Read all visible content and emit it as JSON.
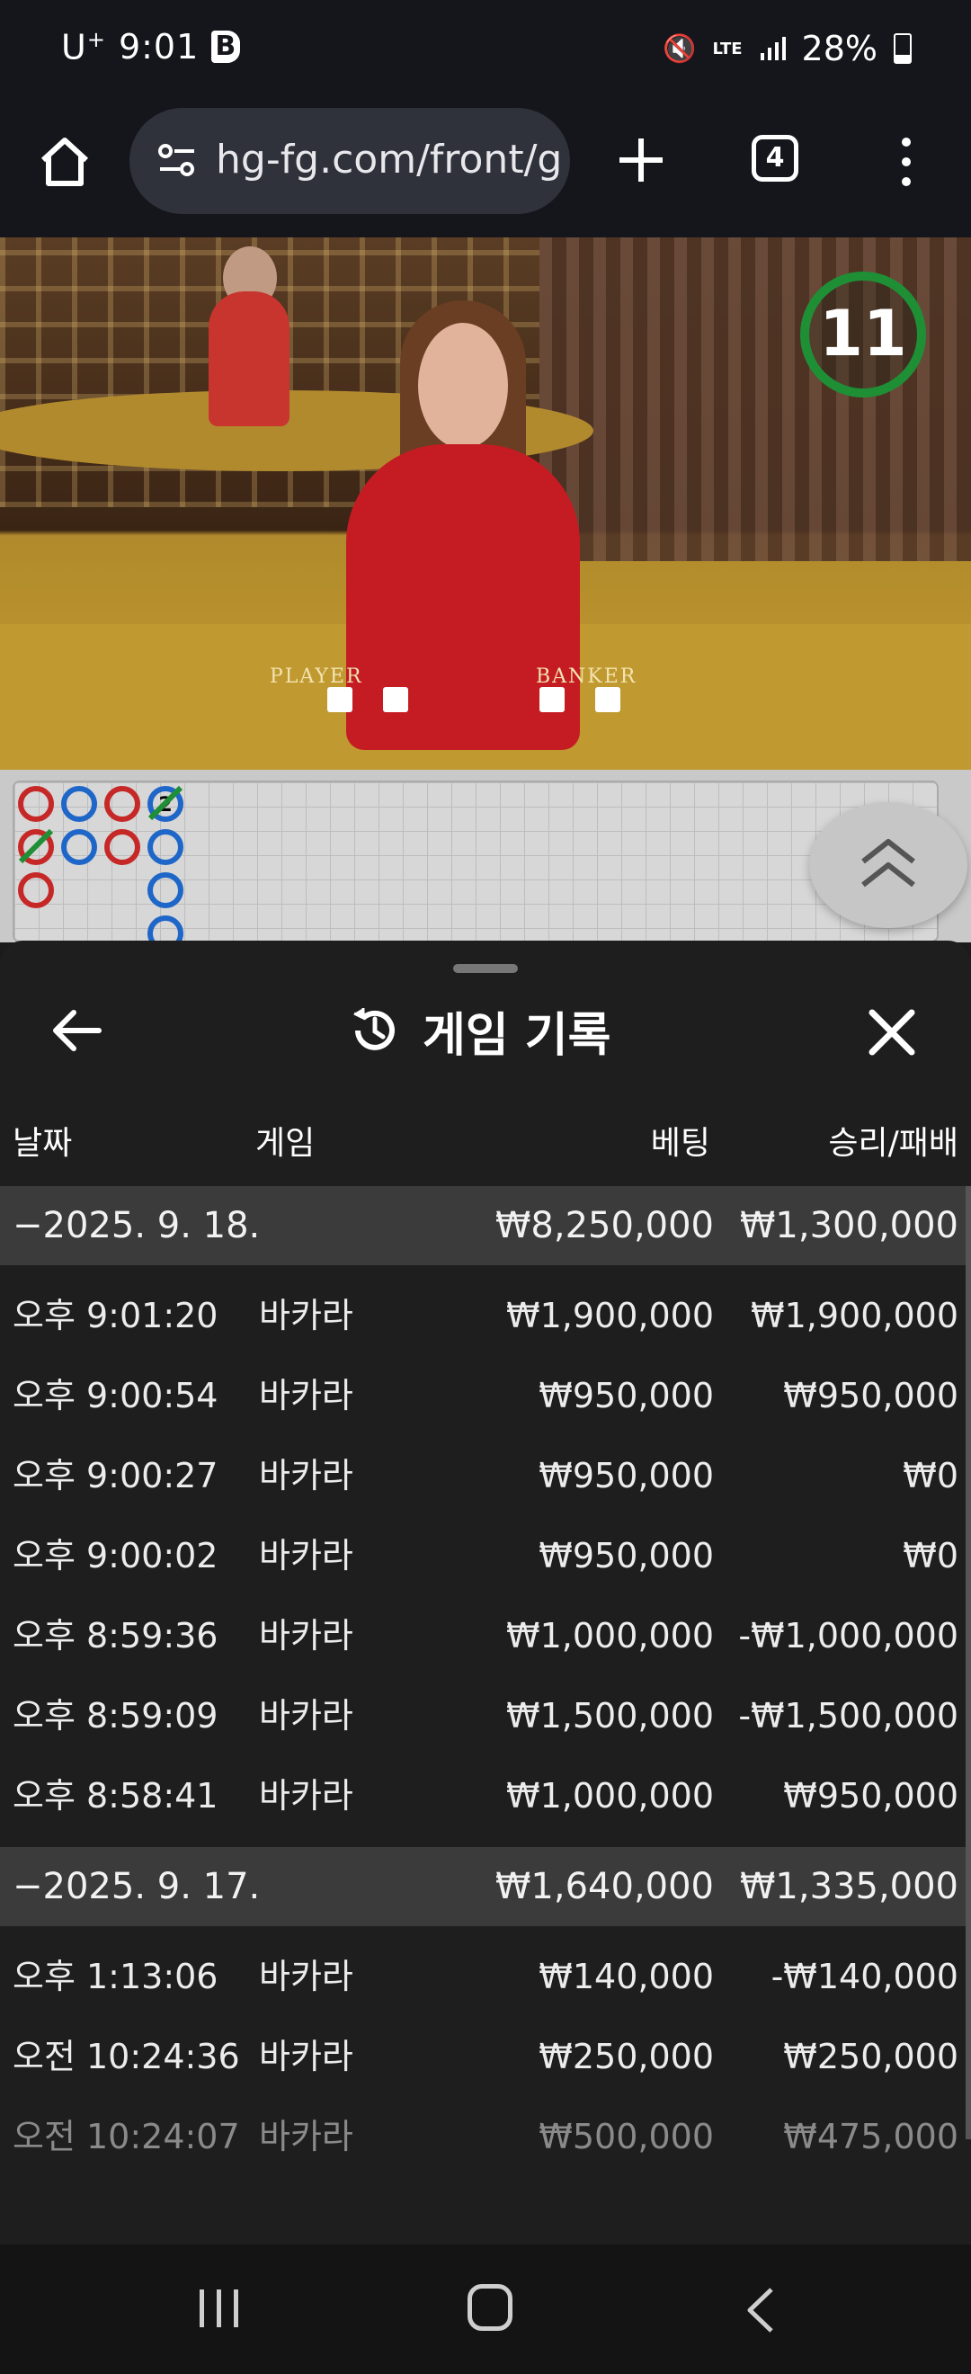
{
  "status_bar": {
    "carrier": "U",
    "carrier_sup": "+",
    "time": "9:01",
    "app_badge": "B",
    "network": "LTE",
    "battery": "28%"
  },
  "browser": {
    "url": "hg-fg.com/front/g",
    "tab_count": "4",
    "icons": [
      "home-icon",
      "site-info-icon",
      "new-tab-icon",
      "tabs-icon",
      "more-icon"
    ]
  },
  "video": {
    "timer": "11",
    "felt_labels": [
      "PLAYER",
      "BANKER"
    ]
  },
  "roadmap": {
    "marker_number": "2"
  },
  "sheet": {
    "title": "게임 기록",
    "columns": {
      "date": "날짜",
      "game": "게임",
      "bet": "베팅",
      "win_loss": "승리/패배"
    },
    "groups": [
      {
        "date": "−2025. 9. 18.",
        "bet": "₩8,250,000",
        "win_loss": "₩1,300,000",
        "rows": [
          {
            "time": "오후 9:01:20",
            "game": "바카라",
            "bet": "₩1,900,000",
            "win_loss": "₩1,900,000"
          },
          {
            "time": "오후 9:00:54",
            "game": "바카라",
            "bet": "₩950,000",
            "win_loss": "₩950,000"
          },
          {
            "time": "오후 9:00:27",
            "game": "바카라",
            "bet": "₩950,000",
            "win_loss": "₩0"
          },
          {
            "time": "오후 9:00:02",
            "game": "바카라",
            "bet": "₩950,000",
            "win_loss": "₩0"
          },
          {
            "time": "오후 8:59:36",
            "game": "바카라",
            "bet": "₩1,000,000",
            "win_loss": "-₩1,000,000"
          },
          {
            "time": "오후 8:59:09",
            "game": "바카라",
            "bet": "₩1,500,000",
            "win_loss": "-₩1,500,000"
          },
          {
            "time": "오후 8:58:41",
            "game": "바카라",
            "bet": "₩1,000,000",
            "win_loss": "₩950,000"
          }
        ]
      },
      {
        "date": "−2025. 9. 17.",
        "bet": "₩1,640,000",
        "win_loss": "₩1,335,000",
        "rows": [
          {
            "time": "오후 1:13:06",
            "game": "바카라",
            "bet": "₩140,000",
            "win_loss": "-₩140,000"
          },
          {
            "time": "오전 10:24:36",
            "game": "바카라",
            "bet": "₩250,000",
            "win_loss": "₩250,000"
          },
          {
            "time": "오전 10:24:07",
            "game": "바카라",
            "bet": "₩500,000",
            "win_loss": "₩475,000"
          }
        ]
      }
    ]
  },
  "colors": {
    "sheet_bg": "#1e1e1e",
    "group_row_bg": "#3b3b3b",
    "timer_ring": "#1f8f36",
    "banker_red": "#c62828",
    "player_blue": "#1e66c8"
  }
}
